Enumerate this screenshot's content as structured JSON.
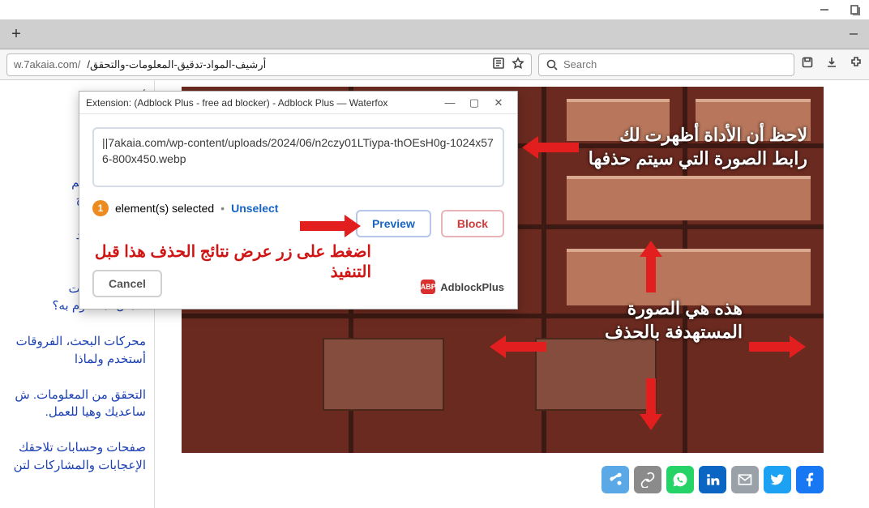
{
  "window": {
    "title": ""
  },
  "url": {
    "host_prefix": "w.7akaia.com/",
    "path_rtl": "أرشيف-المواد-تدقيق-المعلومات-والتحقق/"
  },
  "search": {
    "placeholder": "Search"
  },
  "sidebar": {
    "top_label": "أ",
    "items": [
      "Waterf... تحا\nقيق المعلوما",
      "رك البحث كالم\nوتضييق النتائج",
      "أساسية في تد\nوالتحقق من ا",
      "ترنت.. هل أخت\nالأمثل لما أقوم به؟",
      "محركات البحث، الفروقات\nأستخدم ولماذا",
      "التحقق من المعلومات. ش\nساعديك وهيا للعمل.",
      "صفحات وحسابات تلاحقك\nالإعجابات والمشاركات لتن"
    ]
  },
  "dialog": {
    "title": "Extension: (Adblock Plus - free ad blocker) - Adblock Plus — Waterfox",
    "url_value": "||7akaia.com/wp-content/uploads/2024/06/n2czy01LTiypa-thOEsH0g-1024x576-800x450.webp",
    "selected_count": "1",
    "selected_label": "element(s) selected",
    "unselect": "Unselect",
    "preview": "Preview",
    "block": "Block",
    "cancel": "Cancel",
    "brand": "AdblockPlus",
    "brand_badge": "ABP"
  },
  "annotations": {
    "top_right": "لاحظ أن الأداة أظهرت لك\nرابط الصورة التي سيتم حذفها",
    "mid_right": "هذه هي الصورة\nالمستهدفة بالحذف",
    "red_caption": "اضغط على زر عرض نتائج الحذف هذا قبل التنفيذ"
  },
  "share": {
    "items": [
      {
        "name": "share-generic",
        "color": "#5aa9e6"
      },
      {
        "name": "link",
        "color": "#8b8b8b"
      },
      {
        "name": "whatsapp",
        "color": "#25d366"
      },
      {
        "name": "linkedin",
        "color": "#0a66c2"
      },
      {
        "name": "email",
        "color": "#9aa1a8"
      },
      {
        "name": "twitter",
        "color": "#1da1f2"
      },
      {
        "name": "facebook",
        "color": "#1877f2"
      }
    ]
  }
}
